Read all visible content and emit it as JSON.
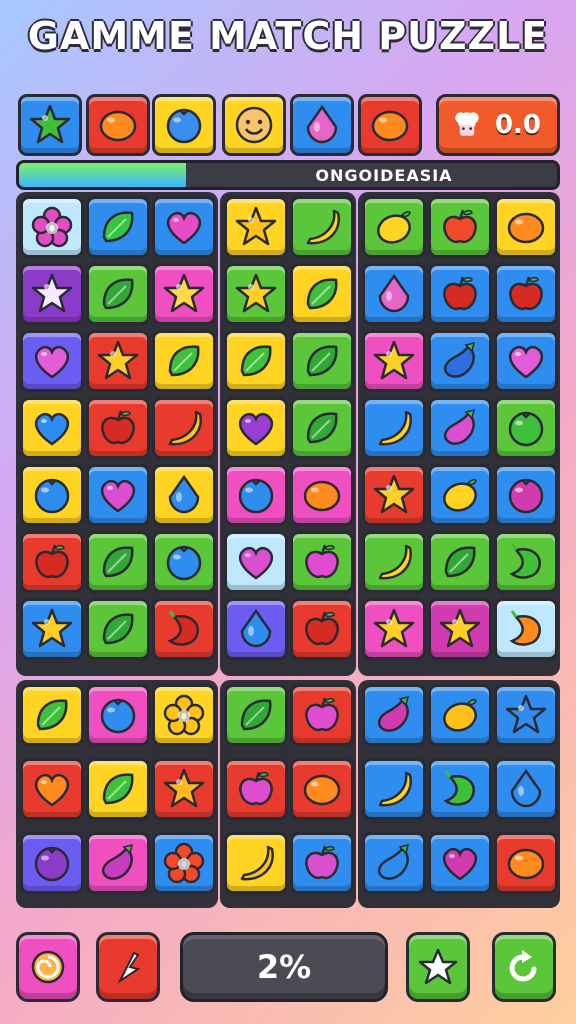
{
  "title": "GAMME MATCH PUZZLE",
  "score": "0.0",
  "progress": {
    "label": "ONGOIDEASIA",
    "fill_percent": 31
  },
  "percent_display": "2%",
  "colors": {
    "yellow": "#ffd422",
    "orange": "#f26b1d",
    "red": "#e83b2e",
    "blue": "#2f8df0",
    "green": "#5bc639",
    "purple": "#8a3cc8",
    "pink": "#ef4fc0",
    "lightblue": "#bfe8ff",
    "magenta": "#d23bb0",
    "violet": "#6b5cf2"
  },
  "top_bar": [
    {
      "bg": "blue",
      "icon": "star-icon",
      "ic": "#3fbf3a"
    },
    {
      "bg": "red",
      "icon": "orange-fruit-icon",
      "ic": "#ff8a1d"
    },
    {
      "bg": "yellow",
      "icon": "blueberry-icon",
      "ic": "#3a8ef0"
    },
    {
      "bg": "yellow",
      "icon": "smiley-face-icon",
      "ic": "#f7c46a"
    },
    {
      "bg": "blue",
      "icon": "drop-gem-icon",
      "ic": "#e466c8"
    },
    {
      "bg": "red",
      "icon": "orange-fruit-icon",
      "ic": "#ff8a1d"
    }
  ],
  "board": {
    "left": [
      [
        {
          "bg": "lightblue",
          "icon": "flower-icon",
          "ic": "#e24cc5"
        },
        {
          "bg": "blue",
          "icon": "leaf-icon",
          "ic": "#37c443"
        },
        {
          "bg": "blue",
          "icon": "heart-icon",
          "ic": "#e74cc8"
        }
      ],
      [
        {
          "bg": "purple",
          "icon": "star-icon",
          "ic": "#f7e9ff"
        },
        {
          "bg": "green",
          "icon": "leaf-icon",
          "ic": "#2fa834"
        },
        {
          "bg": "pink",
          "icon": "star-icon",
          "ic": "#ffd84a"
        }
      ],
      [
        {
          "bg": "violet",
          "icon": "heart-icon",
          "ic": "#e35cd8"
        },
        {
          "bg": "red",
          "icon": "star-icon",
          "ic": "#ffcf26"
        },
        {
          "bg": "yellow",
          "icon": "leaf-icon",
          "ic": "#3ec03a"
        }
      ],
      [
        {
          "bg": "yellow",
          "icon": "heart-icon",
          "ic": "#2f8df0"
        },
        {
          "bg": "red",
          "icon": "apple-icon",
          "ic": "#d62b22"
        },
        {
          "bg": "red",
          "icon": "banana-icon",
          "ic": "#ffc21a"
        }
      ],
      [
        {
          "bg": "yellow",
          "icon": "blueberry-icon",
          "ic": "#2f8df0"
        },
        {
          "bg": "blue",
          "icon": "heart-icon",
          "ic": "#d94fd0"
        },
        {
          "bg": "yellow",
          "icon": "drop-gem-icon",
          "ic": "#2f8df0"
        }
      ],
      [
        {
          "bg": "red",
          "icon": "apple-icon",
          "ic": "#d62b22"
        },
        {
          "bg": "green",
          "icon": "leaf-icon",
          "ic": "#2fa834"
        },
        {
          "bg": "green",
          "icon": "blueberry-icon",
          "ic": "#2f8df0"
        }
      ],
      [
        {
          "bg": "blue",
          "icon": "star-icon",
          "ic": "#ffcf26"
        },
        {
          "bg": "green",
          "icon": "leaf-icon",
          "ic": "#2fa834"
        },
        {
          "bg": "red",
          "icon": "pepper-icon",
          "ic": "#d62b22"
        }
      ]
    ],
    "middle": [
      [
        {
          "bg": "yellow",
          "icon": "star-icon",
          "ic": "#ffc21a"
        },
        {
          "bg": "green",
          "icon": "banana-icon",
          "ic": "#ffd422"
        }
      ],
      [
        {
          "bg": "green",
          "icon": "star-icon",
          "ic": "#ffcf26"
        },
        {
          "bg": "yellow",
          "icon": "leaf-icon",
          "ic": "#3ec03a"
        }
      ],
      [
        {
          "bg": "yellow",
          "icon": "leaf-icon",
          "ic": "#3ec03a"
        },
        {
          "bg": "green",
          "icon": "leaf-icon",
          "ic": "#2fa834"
        }
      ],
      [
        {
          "bg": "yellow",
          "icon": "heart-icon",
          "ic": "#9a3fd6"
        },
        {
          "bg": "green",
          "icon": "leaf-icon",
          "ic": "#2fa834"
        }
      ],
      [
        {
          "bg": "pink",
          "icon": "blueberry-icon",
          "ic": "#2f8df0"
        },
        {
          "bg": "pink",
          "icon": "orange-fruit-icon",
          "ic": "#ff8a1d"
        }
      ],
      [
        {
          "bg": "lightblue",
          "icon": "heart-icon",
          "ic": "#d94fd0"
        },
        {
          "bg": "green",
          "icon": "apple-icon",
          "ic": "#e04ccf"
        }
      ],
      [
        {
          "bg": "violet",
          "icon": "drop-gem-icon",
          "ic": "#2f8df0"
        },
        {
          "bg": "red",
          "icon": "apple-icon",
          "ic": "#d62b22"
        }
      ]
    ],
    "right": [
      [
        {
          "bg": "green",
          "icon": "lemon-icon",
          "ic": "#ffd422"
        },
        {
          "bg": "green",
          "icon": "apple-icon",
          "ic": "#f04a2a"
        },
        {
          "bg": "yellow",
          "icon": "orange-fruit-icon",
          "ic": "#ff8a1d"
        }
      ],
      [
        {
          "bg": "blue",
          "icon": "drop-gem-icon",
          "ic": "#e466c8"
        },
        {
          "bg": "blue",
          "icon": "apple-icon",
          "ic": "#d62b22"
        },
        {
          "bg": "blue",
          "icon": "apple-icon",
          "ic": "#d62b22"
        }
      ],
      [
        {
          "bg": "pink",
          "icon": "star-icon",
          "ic": "#ffcf26"
        },
        {
          "bg": "blue",
          "icon": "eggplant-icon",
          "ic": "#2f6de0"
        },
        {
          "bg": "blue",
          "icon": "heart-icon",
          "ic": "#e35cd8"
        }
      ],
      [
        {
          "bg": "blue",
          "icon": "banana-icon",
          "ic": "#ffd422"
        },
        {
          "bg": "blue",
          "icon": "eggplant-icon",
          "ic": "#d94fd0"
        },
        {
          "bg": "green",
          "icon": "blueberry-icon",
          "ic": "#3ec03a"
        }
      ],
      [
        {
          "bg": "red",
          "icon": "star-icon",
          "ic": "#ffcf26"
        },
        {
          "bg": "blue",
          "icon": "lemon-icon",
          "ic": "#ffd422"
        },
        {
          "bg": "blue",
          "icon": "blueberry-icon",
          "ic": "#d23bb0"
        }
      ],
      [
        {
          "bg": "green",
          "icon": "banana-icon",
          "ic": "#ffd422"
        },
        {
          "bg": "green",
          "icon": "leaf-icon",
          "ic": "#2fa834"
        },
        {
          "bg": "green",
          "icon": "pepper-icon",
          "ic": "#3ec03a"
        }
      ],
      [
        {
          "bg": "pink",
          "icon": "star-icon",
          "ic": "#ffcf26"
        },
        {
          "bg": "magenta",
          "icon": "star-icon",
          "ic": "#ffcf26"
        },
        {
          "bg": "lightblue",
          "icon": "pepper-icon",
          "ic": "#ff8a1d"
        }
      ]
    ],
    "bottom_left": [
      [
        {
          "bg": "yellow",
          "icon": "leaf-icon",
          "ic": "#3ec03a"
        },
        {
          "bg": "pink",
          "icon": "blueberry-icon",
          "ic": "#2f8df0"
        },
        {
          "bg": "yellow",
          "icon": "flower-icon",
          "ic": "#ffc21a"
        }
      ],
      [
        {
          "bg": "red",
          "icon": "heart-icon",
          "ic": "#ff8a1d"
        },
        {
          "bg": "yellow",
          "icon": "leaf-icon",
          "ic": "#3ec03a"
        },
        {
          "bg": "red",
          "icon": "star-icon",
          "ic": "#ffb81f"
        }
      ],
      [
        {
          "bg": "violet",
          "icon": "blueberry-icon",
          "ic": "#8a3cc8"
        },
        {
          "bg": "pink",
          "icon": "eggplant-icon",
          "ic": "#c93cc0"
        },
        {
          "bg": "blue",
          "icon": "flower-icon",
          "ic": "#f04a2a"
        }
      ]
    ],
    "bottom_middle": [
      [
        {
          "bg": "green",
          "icon": "leaf-icon",
          "ic": "#2fa834"
        },
        {
          "bg": "red",
          "icon": "apple-icon",
          "ic": "#e04ccf"
        }
      ],
      [
        {
          "bg": "red",
          "icon": "apple-icon",
          "ic": "#e04ccf"
        },
        {
          "bg": "red",
          "icon": "orange-fruit-icon",
          "ic": "#ff8a1d"
        }
      ],
      [
        {
          "bg": "yellow",
          "icon": "banana-icon",
          "ic": "#ffc21a"
        },
        {
          "bg": "blue",
          "icon": "apple-icon",
          "ic": "#d94fd0"
        }
      ]
    ],
    "bottom_right": [
      [
        {
          "bg": "blue",
          "icon": "eggplant-icon",
          "ic": "#d23bb0"
        },
        {
          "bg": "blue",
          "icon": "lemon-icon",
          "ic": "#ffc21a"
        },
        {
          "bg": "blue",
          "icon": "star-icon",
          "ic": "#2f8df0"
        }
      ],
      [
        {
          "bg": "blue",
          "icon": "banana-icon",
          "ic": "#ffd422"
        },
        {
          "bg": "blue",
          "icon": "pepper-icon",
          "ic": "#3ec03a"
        },
        {
          "bg": "blue",
          "icon": "drop-gem-icon",
          "ic": "#2f8df0"
        }
      ],
      [
        {
          "bg": "blue",
          "icon": "eggplant-icon",
          "ic": "#2f8df0"
        },
        {
          "bg": "blue",
          "icon": "heart-icon",
          "ic": "#d23bb0"
        },
        {
          "bg": "red",
          "icon": "orange-fruit-icon",
          "ic": "#ff8a1d"
        }
      ]
    ]
  },
  "bottom_bar": [
    {
      "name": "swap-button",
      "bg": "pink",
      "icon": "swirl-icon"
    },
    {
      "name": "hint-button",
      "bg": "red",
      "icon": "flag-icon"
    },
    {
      "name": "star-bonus-button",
      "bg": "green",
      "icon": "star-icon"
    },
    {
      "name": "restart-button",
      "bg": "green",
      "icon": "restart-icon"
    }
  ]
}
